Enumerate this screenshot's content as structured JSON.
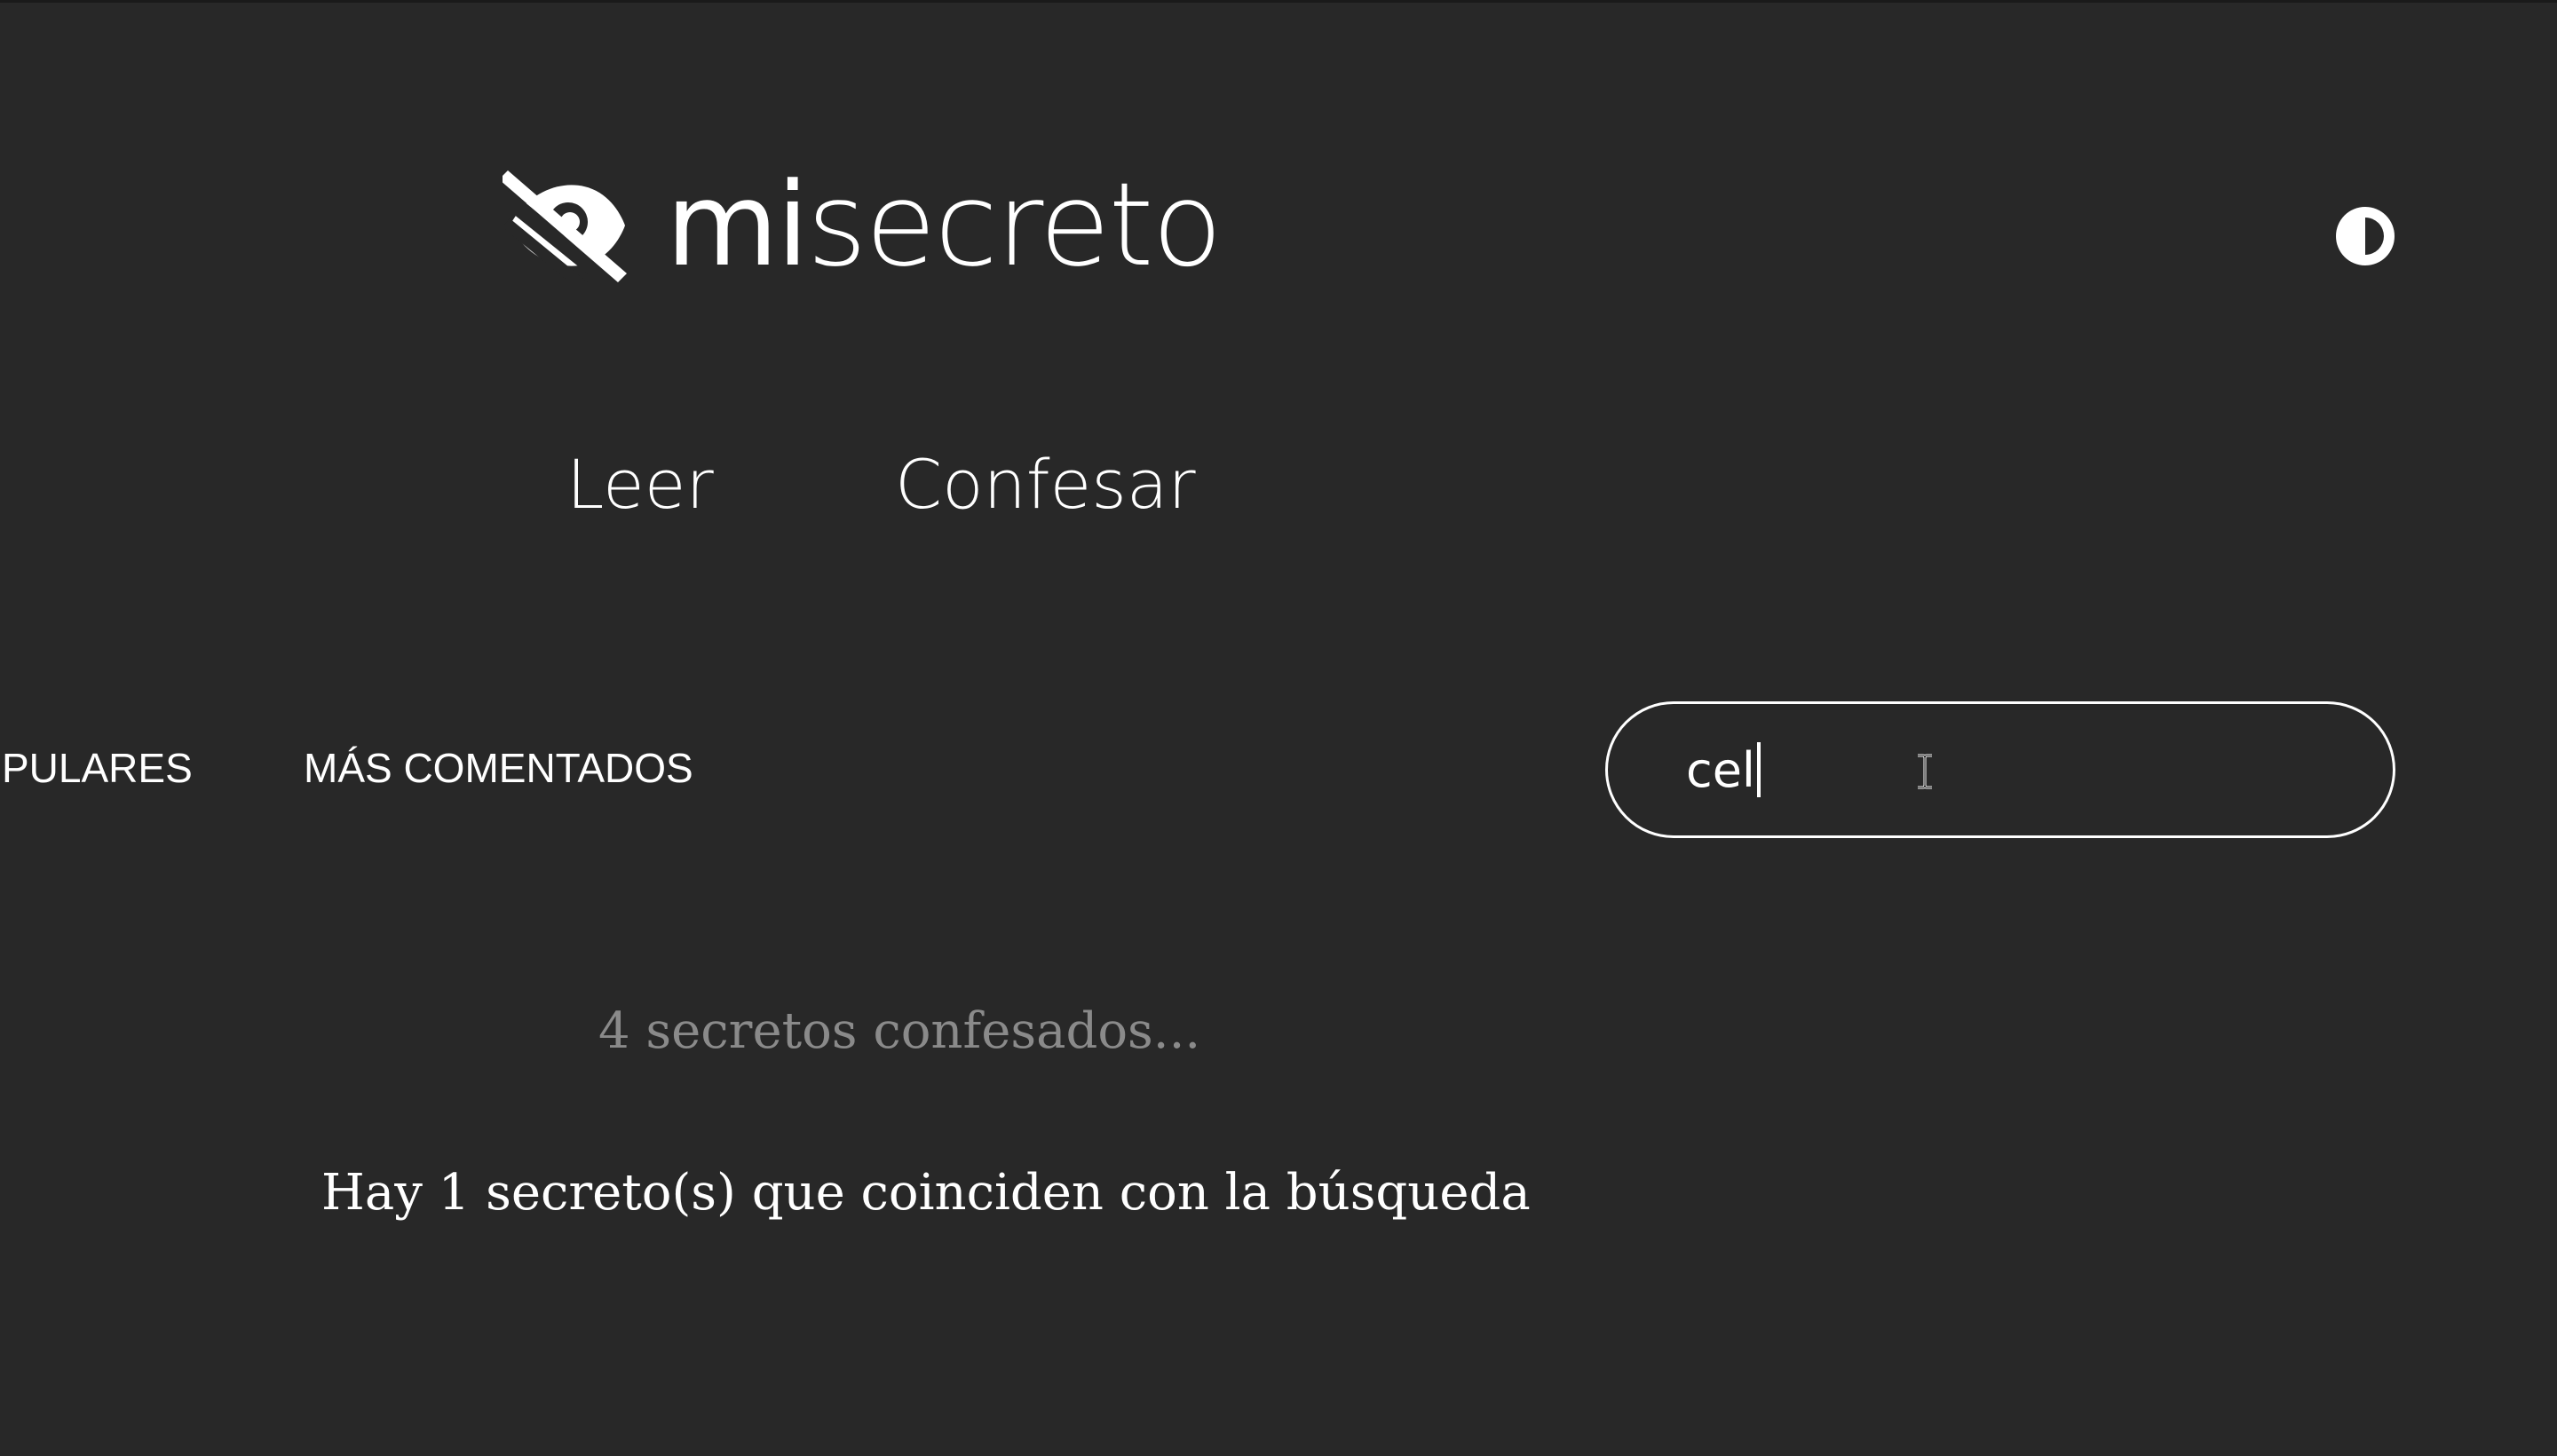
{
  "header": {
    "logo": {
      "prefix": "mi",
      "suffix": "secreto",
      "icon": "eye-slash-icon"
    },
    "theme_toggle_icon": "contrast-half-circle-icon"
  },
  "nav": {
    "leer": "Leer",
    "confesar": "Confesar"
  },
  "filters": {
    "populares": "PULARES",
    "mas_comentados": "MÁS COMENTADOS"
  },
  "search": {
    "value": "cel"
  },
  "stats": {
    "count_text": "4 secretos confesados..."
  },
  "results": {
    "summary": "Hay 1 secreto(s) que coinciden con la búsqueda"
  },
  "colors": {
    "background": "#282828",
    "text": "#ffffff",
    "muted_text": "#8a8a8a"
  }
}
